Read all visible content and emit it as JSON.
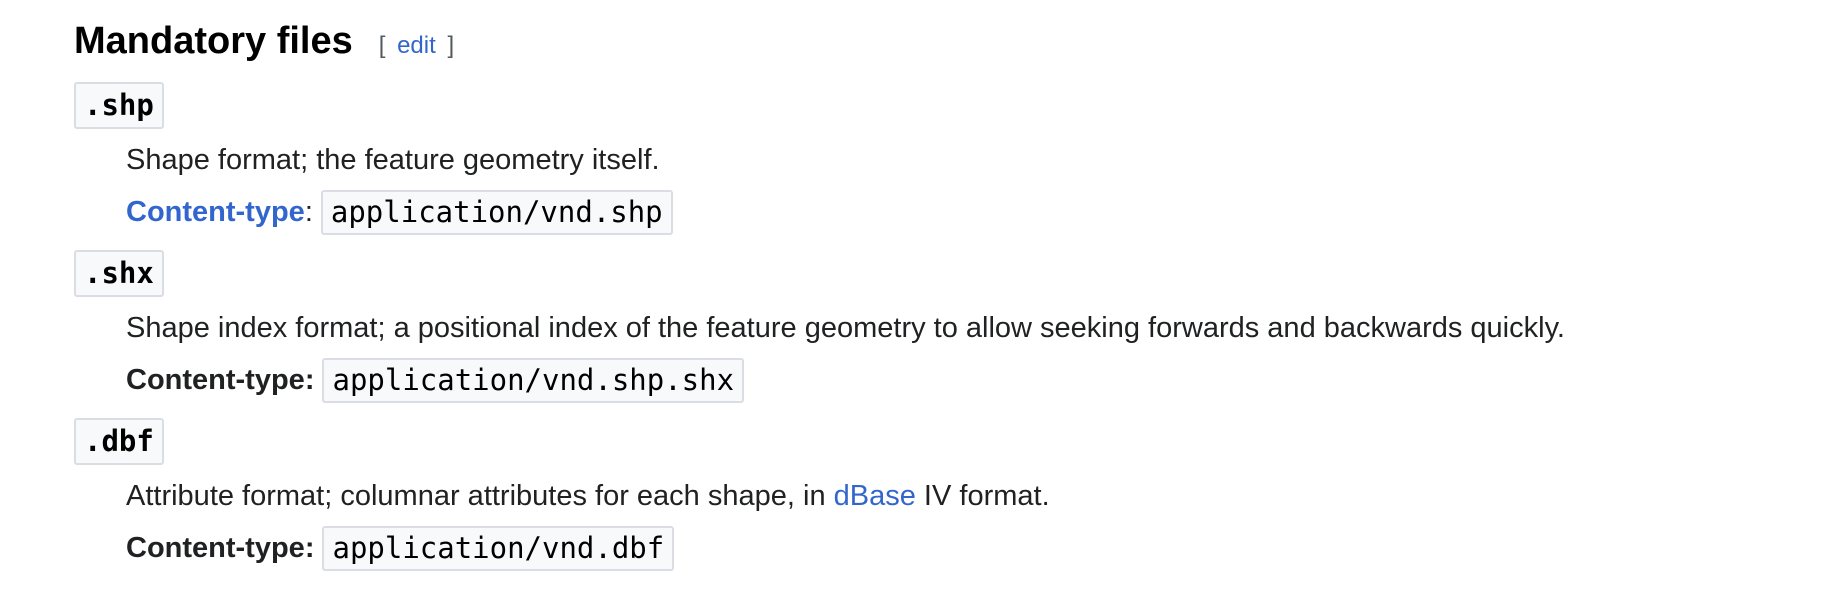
{
  "section": {
    "title": "Mandatory files",
    "edit_open": "[",
    "edit_label": "edit",
    "edit_close": "]"
  },
  "entries": [
    {
      "extension": ".shp",
      "description": "Shape format; the feature geometry itself.",
      "content_type_label": "Content-type",
      "content_type_colon": ":",
      "content_type_value": "application/vnd.shp"
    },
    {
      "extension": ".shx",
      "description": "Shape index format; a positional index of the feature geometry to allow seeking forwards and backwards quickly.",
      "content_type_label": "Content-type:",
      "content_type_value": "application/vnd.shp.shx"
    },
    {
      "extension": ".dbf",
      "description_before": "Attribute format; columnar attributes for each shape, in ",
      "description_link": "dBase",
      "description_after": " IV format.",
      "content_type_label": "Content-type:",
      "content_type_value": "application/vnd.dbf"
    }
  ],
  "colors": {
    "link": "#3366cc",
    "text": "#202122",
    "code_background": "#f8f9fa",
    "code_border": "#dadde3"
  }
}
